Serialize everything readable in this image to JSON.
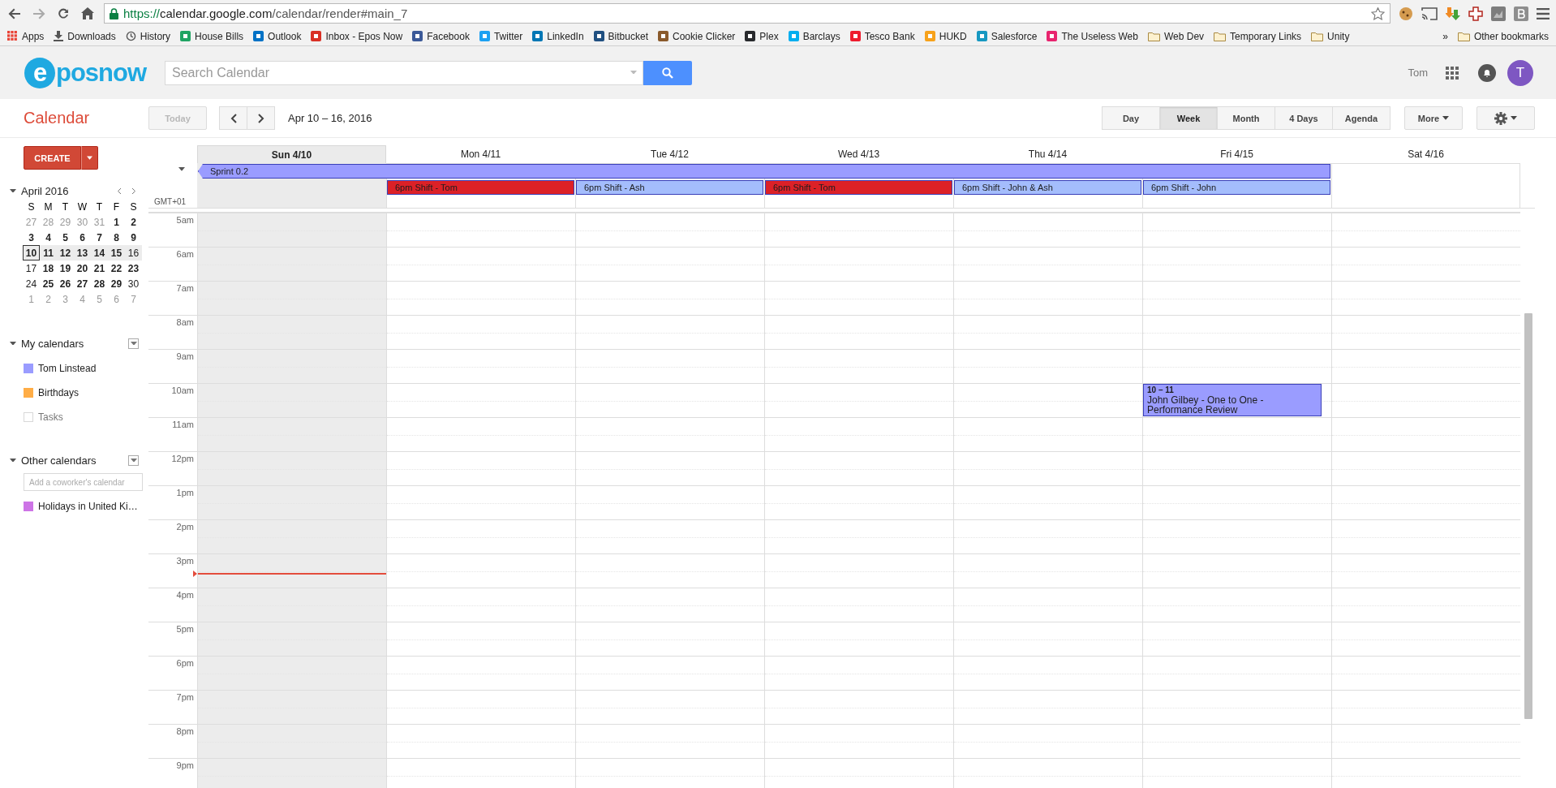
{
  "browser": {
    "url": {
      "scheme": "https://",
      "host": "calendar.google.com",
      "path": "/calendar/render#main_7"
    },
    "bookmarks": [
      {
        "label": "Apps",
        "kind": "apps"
      },
      {
        "label": "Downloads",
        "kind": "download"
      },
      {
        "label": "History",
        "kind": "history"
      },
      {
        "label": "House Bills",
        "kind": "site",
        "color": "#1fa463"
      },
      {
        "label": "Outlook",
        "kind": "site",
        "color": "#0072c6"
      },
      {
        "label": "Inbox - Epos Now",
        "kind": "site",
        "color": "#d93025"
      },
      {
        "label": "Facebook",
        "kind": "site",
        "color": "#3b5998"
      },
      {
        "label": "Twitter",
        "kind": "site",
        "color": "#1da1f2"
      },
      {
        "label": "LinkedIn",
        "kind": "site",
        "color": "#0077b5"
      },
      {
        "label": "Bitbucket",
        "kind": "site",
        "color": "#205081"
      },
      {
        "label": "Cookie Clicker",
        "kind": "site",
        "color": "#8a5a2b"
      },
      {
        "label": "Plex",
        "kind": "site",
        "color": "#282a2d"
      },
      {
        "label": "Barclays",
        "kind": "site",
        "color": "#00aeef"
      },
      {
        "label": "Tesco Bank",
        "kind": "site",
        "color": "#ee1c2e"
      },
      {
        "label": "HUKD",
        "kind": "site",
        "color": "#f7a21b"
      },
      {
        "label": "Salesforce",
        "kind": "site",
        "color": "#1798c1"
      },
      {
        "label": "The Useless Web",
        "kind": "site",
        "color": "#e8246e"
      },
      {
        "label": "Web Dev",
        "kind": "folder"
      },
      {
        "label": "Temporary Links",
        "kind": "folder"
      },
      {
        "label": "Unity",
        "kind": "folder"
      }
    ],
    "overflow": "»",
    "other_bookmarks": "Other bookmarks"
  },
  "header": {
    "logo": {
      "mark": "e",
      "text": "posnow"
    },
    "search": {
      "placeholder": "Search Calendar"
    },
    "user": "Tom",
    "avatar": "T"
  },
  "toolbar": {
    "title": "Calendar",
    "today": {
      "label": "Today",
      "disabled": true
    },
    "date_range": "Apr 10 – 16, 2016",
    "views": [
      {
        "label": "Day",
        "selected": false
      },
      {
        "label": "Week",
        "selected": true
      },
      {
        "label": "Month",
        "selected": false
      },
      {
        "label": "4 Days",
        "selected": false
      },
      {
        "label": "Agenda",
        "selected": false
      }
    ],
    "more": "More"
  },
  "sidebar": {
    "create": "CREATE",
    "mini_calendar": {
      "month": "April 2016",
      "weekdays": [
        "S",
        "M",
        "T",
        "W",
        "T",
        "F",
        "S"
      ],
      "weeks": [
        {
          "selected": false,
          "days": [
            {
              "label": "27",
              "muted": true,
              "bold": false,
              "today": false
            },
            {
              "label": "28",
              "muted": true,
              "bold": false,
              "today": false
            },
            {
              "label": "29",
              "muted": true,
              "bold": false,
              "today": false
            },
            {
              "label": "30",
              "muted": true,
              "bold": false,
              "today": false
            },
            {
              "label": "31",
              "muted": true,
              "bold": false,
              "today": false
            },
            {
              "label": "1",
              "muted": false,
              "bold": true,
              "today": false
            },
            {
              "label": "2",
              "muted": false,
              "bold": true,
              "today": false
            }
          ]
        },
        {
          "selected": false,
          "days": [
            {
              "label": "3",
              "muted": false,
              "bold": true,
              "today": false
            },
            {
              "label": "4",
              "muted": false,
              "bold": true,
              "today": false
            },
            {
              "label": "5",
              "muted": false,
              "bold": true,
              "today": false
            },
            {
              "label": "6",
              "muted": false,
              "bold": true,
              "today": false
            },
            {
              "label": "7",
              "muted": false,
              "bold": true,
              "today": false
            },
            {
              "label": "8",
              "muted": false,
              "bold": true,
              "today": false
            },
            {
              "label": "9",
              "muted": false,
              "bold": true,
              "today": false
            }
          ]
        },
        {
          "selected": true,
          "days": [
            {
              "label": "10",
              "muted": false,
              "bold": true,
              "today": true
            },
            {
              "label": "11",
              "muted": false,
              "bold": true,
              "today": false
            },
            {
              "label": "12",
              "muted": false,
              "bold": true,
              "today": false
            },
            {
              "label": "13",
              "muted": false,
              "bold": true,
              "today": false
            },
            {
              "label": "14",
              "muted": false,
              "bold": true,
              "today": false
            },
            {
              "label": "15",
              "muted": false,
              "bold": true,
              "today": false
            },
            {
              "label": "16",
              "muted": false,
              "bold": false,
              "today": false
            }
          ]
        },
        {
          "selected": false,
          "days": [
            {
              "label": "17",
              "muted": false,
              "bold": false,
              "today": false
            },
            {
              "label": "18",
              "muted": false,
              "bold": true,
              "today": false
            },
            {
              "label": "19",
              "muted": false,
              "bold": true,
              "today": false
            },
            {
              "label": "20",
              "muted": false,
              "bold": true,
              "today": false
            },
            {
              "label": "21",
              "muted": false,
              "bold": true,
              "today": false
            },
            {
              "label": "22",
              "muted": false,
              "bold": true,
              "today": false
            },
            {
              "label": "23",
              "muted": false,
              "bold": true,
              "today": false
            }
          ]
        },
        {
          "selected": false,
          "days": [
            {
              "label": "24",
              "muted": false,
              "bold": false,
              "today": false
            },
            {
              "label": "25",
              "muted": false,
              "bold": true,
              "today": false
            },
            {
              "label": "26",
              "muted": false,
              "bold": true,
              "today": false
            },
            {
              "label": "27",
              "muted": false,
              "bold": true,
              "today": false
            },
            {
              "label": "28",
              "muted": false,
              "bold": true,
              "today": false
            },
            {
              "label": "29",
              "muted": false,
              "bold": true,
              "today": false
            },
            {
              "label": "30",
              "muted": false,
              "bold": false,
              "today": false
            }
          ]
        },
        {
          "selected": false,
          "days": [
            {
              "label": "1",
              "muted": true,
              "bold": false,
              "today": false
            },
            {
              "label": "2",
              "muted": true,
              "bold": false,
              "today": false
            },
            {
              "label": "3",
              "muted": true,
              "bold": false,
              "today": false
            },
            {
              "label": "4",
              "muted": true,
              "bold": false,
              "today": false
            },
            {
              "label": "5",
              "muted": true,
              "bold": false,
              "today": false
            },
            {
              "label": "6",
              "muted": true,
              "bold": false,
              "today": false
            },
            {
              "label": "7",
              "muted": true,
              "bold": false,
              "today": false
            }
          ]
        }
      ]
    },
    "my_calendars": {
      "title": "My calendars",
      "items": [
        {
          "label": "Tom Linstead",
          "visible": true,
          "color": "#9a9cff"
        },
        {
          "label": "Birthdays",
          "visible": true,
          "color": "#ffad46"
        },
        {
          "label": "Tasks",
          "visible": false,
          "color": "#ffffff"
        }
      ]
    },
    "other_calendars": {
      "title": "Other calendars",
      "add": {
        "placeholder": "Add a coworker's calendar"
      },
      "items": [
        {
          "label": "Holidays in United Ki…",
          "visible": true,
          "color": "#cd74e6"
        }
      ]
    }
  },
  "grid": {
    "timezone": "GMT+01",
    "days": [
      {
        "label": "Sun 4/10",
        "selected": true
      },
      {
        "label": "Mon 4/11",
        "selected": false
      },
      {
        "label": "Tue 4/12",
        "selected": false
      },
      {
        "label": "Wed 4/13",
        "selected": false
      },
      {
        "label": "Thu 4/14",
        "selected": false
      },
      {
        "label": "Fri 4/15",
        "selected": false
      },
      {
        "label": "Sat 4/16",
        "selected": false
      }
    ],
    "all_day_rows": [
      [
        {
          "kind": "event",
          "title": "Sprint 0.2",
          "color": "#9a9cff",
          "continues_before": true
        },
        {
          "kind": "continued"
        },
        {
          "kind": "continued"
        },
        {
          "kind": "continued"
        },
        {
          "kind": "continued"
        },
        {
          "kind": "continued"
        },
        {
          "kind": "empty"
        }
      ],
      [
        {
          "kind": "empty"
        },
        {
          "kind": "event",
          "title": "6pm Shift - Tom",
          "color": "#dc2127",
          "continues_before": false
        },
        {
          "kind": "event",
          "title": "6pm Shift - Ash",
          "color": "#a4bdfc",
          "continues_before": false
        },
        {
          "kind": "event",
          "title": "6pm Shift - Tom",
          "color": "#dc2127",
          "continues_before": false
        },
        {
          "kind": "event",
          "title": "6pm Shift - John & Ash",
          "color": "#a4bdfc",
          "continues_before": false
        },
        {
          "kind": "event",
          "title": "6pm Shift - John",
          "color": "#a4bdfc",
          "continues_before": false
        },
        {
          "kind": "empty"
        }
      ]
    ],
    "hours": [
      {
        "label": "5am",
        "now": false
      },
      {
        "label": "6am",
        "now": false
      },
      {
        "label": "7am",
        "now": false
      },
      {
        "label": "8am",
        "now": false
      },
      {
        "label": "9am",
        "now": false
      },
      {
        "label": "10am",
        "now": false,
        "slots": [
          {
            "kind": "empty"
          },
          {
            "kind": "empty"
          },
          {
            "kind": "empty"
          },
          {
            "kind": "empty"
          },
          {
            "kind": "empty"
          },
          {
            "kind": "event",
            "time": "10 – 11",
            "title": "John Gilbey - One to One - Performance Review",
            "color": "#9a9cff"
          },
          {
            "kind": "empty"
          }
        ]
      },
      {
        "label": "11am",
        "now": false
      },
      {
        "label": "12pm",
        "now": false
      },
      {
        "label": "1pm",
        "now": false
      },
      {
        "label": "2pm",
        "now": false
      },
      {
        "label": "3pm",
        "now": true
      },
      {
        "label": "4pm",
        "now": false
      },
      {
        "label": "5pm",
        "now": false
      },
      {
        "label": "6pm",
        "now": false
      },
      {
        "label": "7pm",
        "now": false
      },
      {
        "label": "8pm",
        "now": false
      },
      {
        "label": "9pm",
        "now": false
      }
    ]
  }
}
